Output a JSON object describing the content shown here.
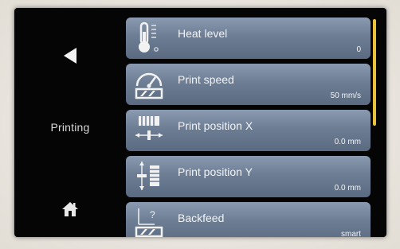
{
  "side": {
    "back_icon": "back-arrow-icon",
    "status_label": "Printing",
    "home_icon": "home-icon"
  },
  "menu": {
    "items": [
      {
        "label": "Heat level",
        "value": "0",
        "icon": "thermometer-icon"
      },
      {
        "label": "Print speed",
        "value": "50 mm/s",
        "icon": "speedometer-icon"
      },
      {
        "label": "Print position X",
        "value": "0.0 mm",
        "icon": "position-x-icon"
      },
      {
        "label": "Print position Y",
        "value": "0.0 mm",
        "icon": "position-y-icon"
      },
      {
        "label": "Backfeed",
        "value": "smart",
        "icon": "backfeed-icon"
      }
    ]
  },
  "colors": {
    "accent": "#e8c23a",
    "menu_item_top": "#8a9ab0",
    "menu_item_bottom": "#5a6a80",
    "screen_bg": "#050505"
  }
}
